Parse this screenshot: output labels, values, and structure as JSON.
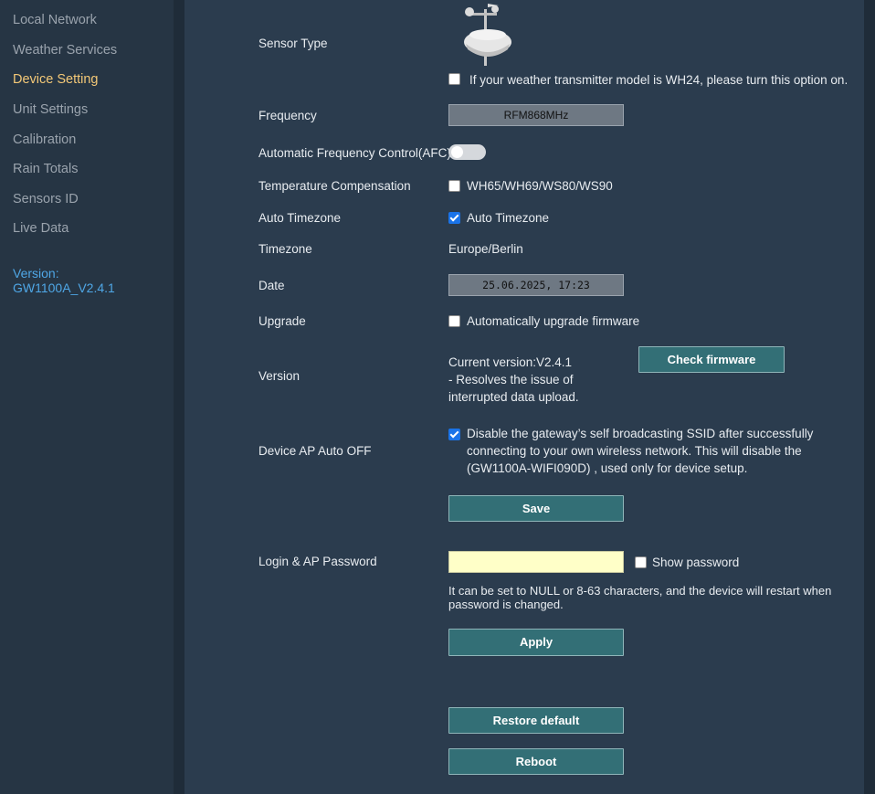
{
  "sidebar": {
    "items": [
      {
        "label": "Local Network"
      },
      {
        "label": "Weather Services"
      },
      {
        "label": "Device Setting"
      },
      {
        "label": "Unit Settings"
      },
      {
        "label": "Calibration"
      },
      {
        "label": "Rain Totals"
      },
      {
        "label": "Sensors ID"
      },
      {
        "label": "Live Data"
      }
    ],
    "version_label": "Version:",
    "version_value": "GW1100A_V2.4.1",
    "active_color": "#f3c877",
    "link_color": "#4fa7e6"
  },
  "settings": {
    "sensor_type": {
      "label": "Sensor Type",
      "wh24_option": "If your weather transmitter model is WH24, please turn this option on.",
      "wh24_checked": false,
      "image_icon": "weather-station-icon"
    },
    "frequency": {
      "label": "Frequency",
      "value": "RFM868MHz"
    },
    "afc": {
      "label": "Automatic Frequency Control(AFC)",
      "enabled": false
    },
    "temp_comp": {
      "label": "Temperature Compensation",
      "option": "WH65/WH69/WS80/WS90",
      "checked": false
    },
    "auto_timezone": {
      "label": "Auto Timezone",
      "option": "Auto Timezone",
      "checked": true
    },
    "timezone": {
      "label": "Timezone",
      "value": "Europe/Berlin"
    },
    "date": {
      "label": "Date",
      "value": "25.06.2025, 17:23"
    },
    "upgrade": {
      "label": "Upgrade",
      "option": "Automatically upgrade firmware",
      "checked": false
    },
    "version": {
      "label": "Version",
      "current": "Current version:V2.4.1",
      "note": "- Resolves the issue of interrupted data upload.",
      "check_button": "Check firmware"
    },
    "ap_auto_off": {
      "label": "Device AP Auto OFF",
      "option": "Disable the gateway’s self broadcasting SSID after successfully connecting to your own wireless network. This will disable the (GW1100A-WIFI090D) , used only for device setup.",
      "checked": true
    },
    "save_button": "Save",
    "password": {
      "label": "Login & AP Password",
      "value": "",
      "show_label": "Show password",
      "show_checked": false,
      "hint": "It can be set to NULL or 8-63 characters, and the device will restart when password is changed.",
      "apply_button": "Apply"
    },
    "restore_button": "Restore default",
    "reboot_button": "Reboot"
  },
  "colors": {
    "background": "#263544",
    "panel": "#2b3c4e",
    "button": "#336f76",
    "password_field": "#ffffc8"
  }
}
